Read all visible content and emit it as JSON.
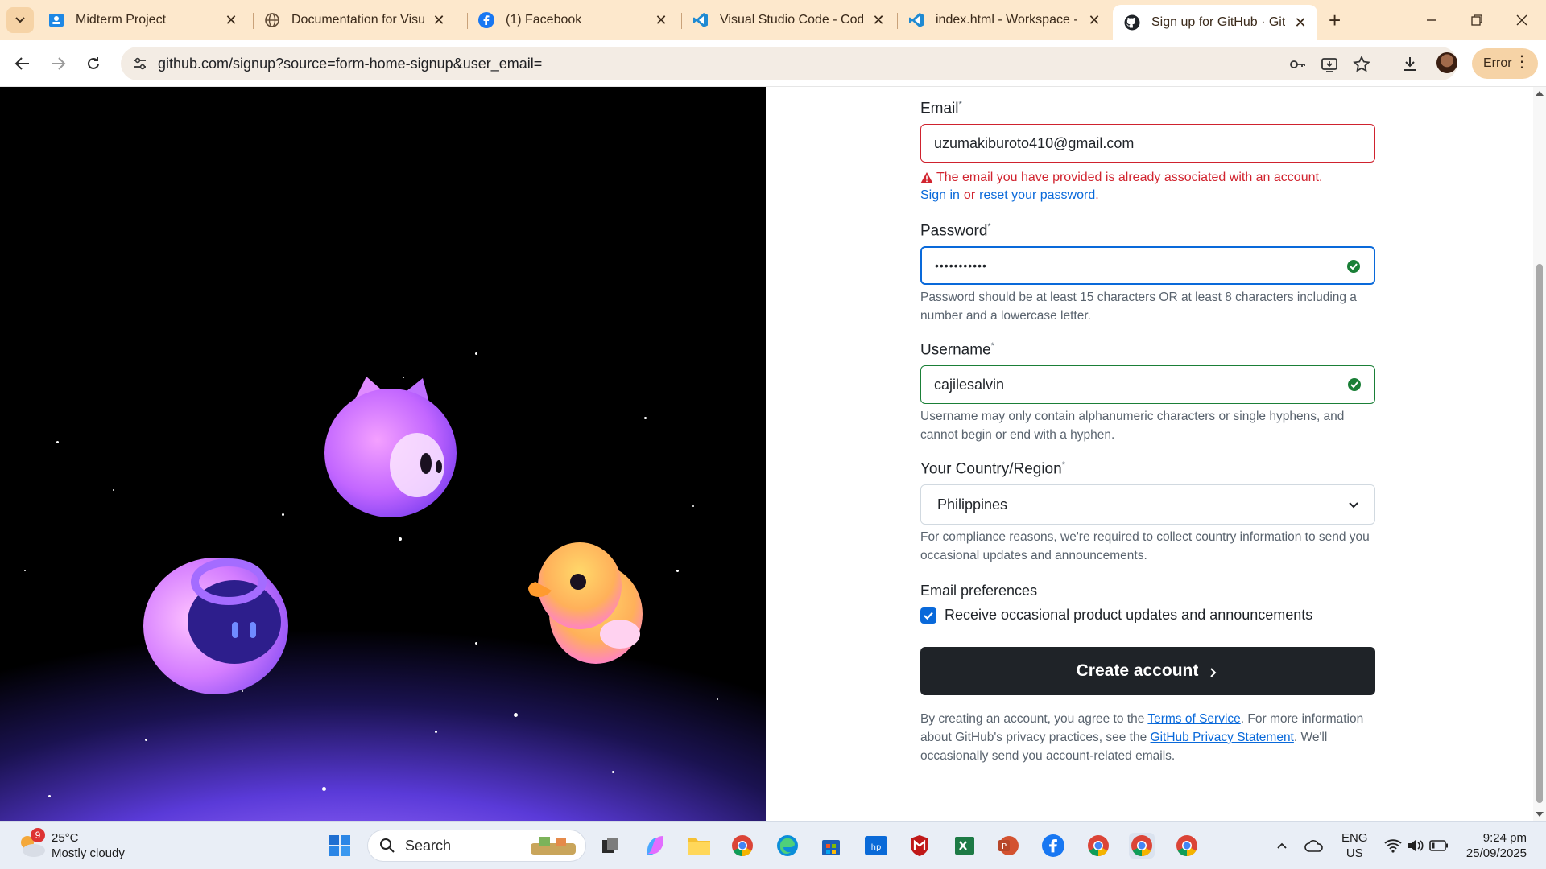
{
  "browser": {
    "tabs": [
      {
        "title": "Midterm Project",
        "icon": "google-classroom-icon"
      },
      {
        "title": "Documentation for Visual Studio Code",
        "icon": "globe-icon"
      },
      {
        "title": "(1) Facebook",
        "icon": "facebook-icon"
      },
      {
        "title": "Visual Studio Code - Code Editing",
        "icon": "vscode-icon"
      },
      {
        "title": "index.html - Workspace - Visual Studio Code",
        "icon": "vscode-icon"
      },
      {
        "title": "Sign up for GitHub · GitHub",
        "icon": "github-icon",
        "active": true
      }
    ],
    "url": "github.com/signup?source=form-home-signup&user_email=",
    "error_label": "Error"
  },
  "form": {
    "email_label": "Email",
    "email_value": "uzumakiburoto410@gmail.com",
    "email_error": "The email you have provided is already associated with an account.",
    "sign_in": "Sign in",
    "or": "or",
    "reset_password": "reset your password",
    "password_label": "Password",
    "password_value": "•••••••••••",
    "password_hint": "Password should be at least 15 characters OR at least 8 characters including a number and a lowercase letter.",
    "username_label": "Username",
    "username_value": "cajilesalvin",
    "username_hint": "Username may only contain alphanumeric characters or single hyphens, and cannot begin or end with a hyphen.",
    "country_label": "Your Country/Region",
    "country_value": "Philippines",
    "country_hint": "For compliance reasons, we're required to collect country information to send you occasional updates and announcements.",
    "email_pref_label": "Email preferences",
    "email_pref_checkbox": "Receive occasional product updates and announcements",
    "email_pref_checked": true,
    "create_button": "Create account",
    "legal_1": "By creating an account, you agree to the",
    "terms": "Terms of Service",
    "legal_2": ". For more information about GitHub's privacy practices, see the",
    "privacy": "GitHub Privacy Statement",
    "legal_3": ". We'll occasionally send you account-related emails."
  },
  "taskbar": {
    "weather_temp": "25°C",
    "weather_desc": "Mostly cloudy",
    "weather_badge": "9",
    "search_placeholder": "Search",
    "lang_1": "ENG",
    "lang_2": "US",
    "time": "9:24 pm",
    "date": "25/09/2025"
  },
  "colors": {
    "github_dark": "#1f2328",
    "error_red": "#d1242f",
    "link_blue": "#0969da",
    "success_green": "#1a7f37",
    "tabstrip": "#fde8cc"
  }
}
